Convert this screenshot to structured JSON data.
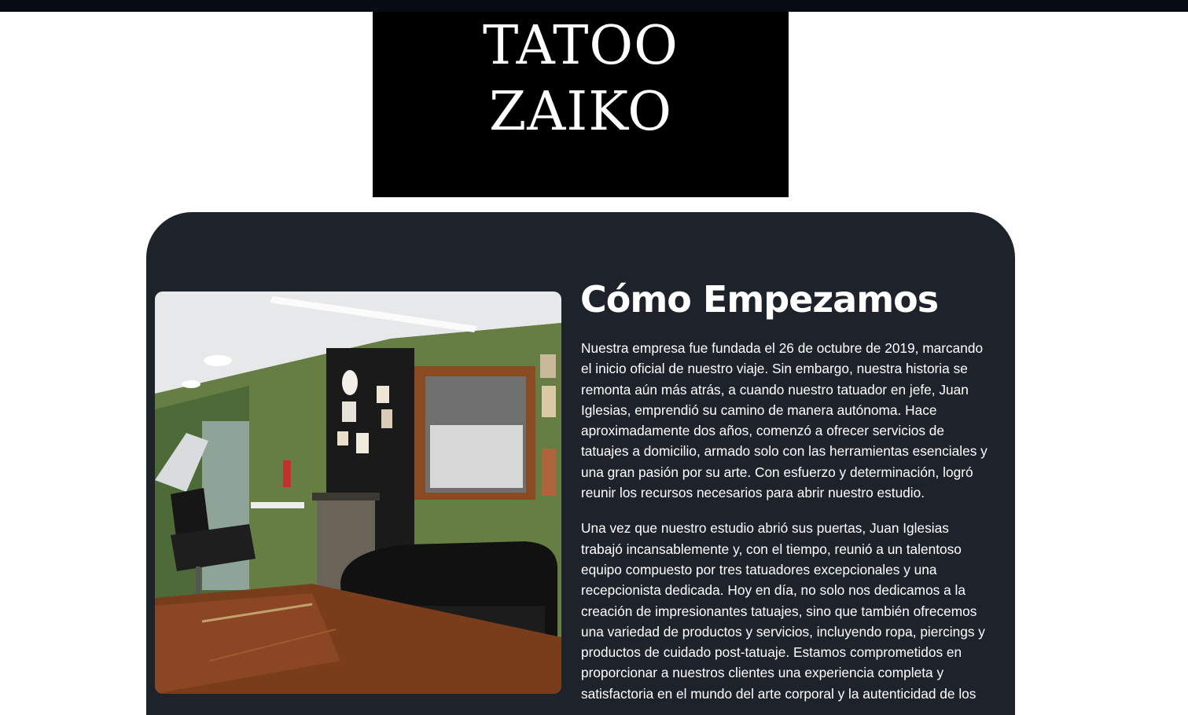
{
  "header": {
    "logo_line1": "TATOO",
    "logo_line2": "ZAIKO"
  },
  "about": {
    "heading": "Cómo Empezamos",
    "image_description": "studio-interior-photo",
    "paragraphs": [
      "Nuestra empresa fue fundada el 26 de octubre de 2019, marcando el inicio oficial de nuestro viaje. Sin embargo, nuestra historia se remonta aún más atrás, a cuando nuestro tatuador en jefe, Juan Iglesias, emprendió su camino de manera autónoma. Hace aproximadamente dos años, comenzó a ofrecer servicios de tatuajes a domicilio, armado solo con las herramientas esenciales y una gran pasión por su arte. Con esfuerzo y determinación, logró reunir los recursos necesarios para abrir nuestro estudio.",
      "Una vez que nuestro estudio abrió sus puertas, Juan Iglesias trabajó incansablemente y, con el tiempo, reunió a un talentoso equipo compuesto por tres tatuadores excepcionales y una recepcionista dedicada. Hoy en día, no solo nos dedicamos a la creación de impresionantes tatuajes, sino que también ofrecemos una variedad de productos y servicios, incluyendo ropa, piercings y productos de cuidado post-tatuaje. Estamos comprometidos en proporcionar a nuestros clientes una experiencia completa y satisfactoria en el mundo del arte corporal y la autenticidad de los"
    ]
  },
  "colors": {
    "topbar": "#070b14",
    "logo_bg": "#000000",
    "card_bg": "#1e232b",
    "text": "#ffffff"
  }
}
